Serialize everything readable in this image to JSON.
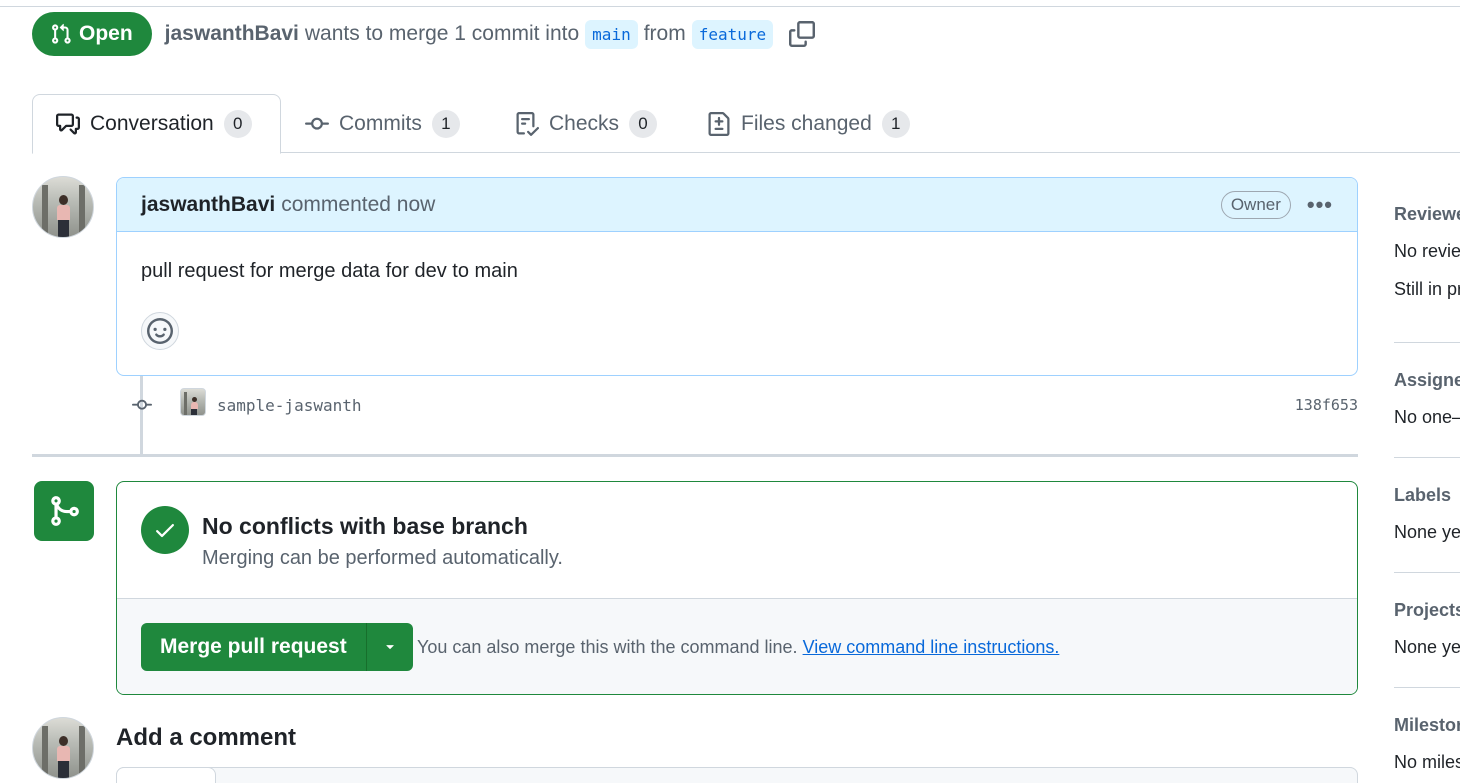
{
  "pr": {
    "state_label": "Open",
    "author": "jaswanthBavi",
    "summary": "wants to merge 1 commit into",
    "base_branch": "main",
    "from_label": "from",
    "head_branch": "feature"
  },
  "tabs": [
    {
      "label": "Conversation",
      "count": "0",
      "icon": "comment-discussion-icon",
      "active": true
    },
    {
      "label": "Commits",
      "count": "1",
      "icon": "git-commit-icon"
    },
    {
      "label": "Checks",
      "count": "0",
      "icon": "checklist-icon"
    },
    {
      "label": "Files changed",
      "count": "1",
      "icon": "file-diff-icon"
    }
  ],
  "comment": {
    "author": "jaswanthBavi",
    "time": "commented now",
    "role_badge": "Owner",
    "body": "pull request for merge data for dev to main"
  },
  "commit": {
    "message": "sample-jaswanth",
    "sha": "138f653"
  },
  "merge": {
    "title": "No conflicts with base branch",
    "subtitle": "Merging can be performed automatically.",
    "button_label": "Merge pull request",
    "hint": "You can also merge this with the command line.",
    "hint_link": "View command line instructions."
  },
  "add_comment": {
    "title": "Add a comment"
  },
  "sidebar": {
    "reviewers": {
      "title": "Reviewe",
      "line1": "No revie",
      "line2": "Still in pr"
    },
    "assignees": {
      "title": "Assigne",
      "value": "No one–"
    },
    "labels": {
      "title": "Labels",
      "value": "None ye"
    },
    "projects": {
      "title": "Projects",
      "value": "None ye"
    },
    "milestone": {
      "title": "Milestor",
      "value": "No miles"
    }
  },
  "colors": {
    "green": "#1f883d",
    "blue_link": "#0969da",
    "comment_header_bg": "#ddf4ff",
    "muted_text": "#59636e"
  }
}
